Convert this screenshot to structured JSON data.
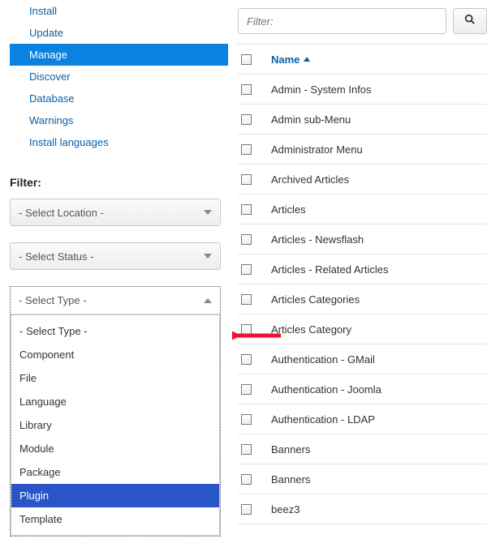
{
  "sidebar": {
    "items": [
      {
        "label": "Install"
      },
      {
        "label": "Update"
      },
      {
        "label": "Manage"
      },
      {
        "label": "Discover"
      },
      {
        "label": "Database"
      },
      {
        "label": "Warnings"
      },
      {
        "label": "Install languages"
      }
    ],
    "activeIndex": 2
  },
  "filter": {
    "heading": "Filter:",
    "location": {
      "label": "- Select Location -"
    },
    "status": {
      "label": "- Select Status -"
    },
    "type": {
      "label": "- Select Type -",
      "options": [
        "- Select Type -",
        "Component",
        "File",
        "Language",
        "Library",
        "Module",
        "Package",
        "Plugin",
        "Template"
      ],
      "hoverIndex": 7
    }
  },
  "search": {
    "placeholder": "Filter:"
  },
  "table": {
    "nameHeader": "Name",
    "rows": [
      "Admin - System Infos",
      "Admin sub-Menu",
      "Administrator Menu",
      "Archived Articles",
      "Articles",
      "Articles - Newsflash",
      "Articles - Related Articles",
      "Articles Categories",
      "Articles Category",
      "Authentication - GMail",
      "Authentication - Joomla",
      "Authentication - LDAP",
      "Banners",
      "Banners",
      "beez3"
    ]
  },
  "icons": {
    "search": "🔍"
  }
}
